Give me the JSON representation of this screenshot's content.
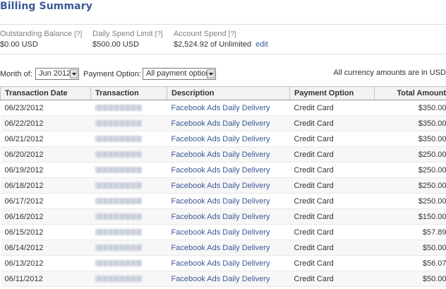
{
  "page": {
    "title": "Billing Summary"
  },
  "stats": {
    "outstanding": {
      "label": "Outstanding Balance",
      "help": "[?]",
      "value": "$0.00 USD"
    },
    "daily_limit": {
      "label": "Daily Spend Limit",
      "help": "[?]",
      "value": "$500.00 USD"
    },
    "account_spend": {
      "label": "Account Spend",
      "help": "[?]",
      "value": "$2,524.92 of Unlimited",
      "edit_link": "edit"
    }
  },
  "filters": {
    "month_label": "Month of:",
    "month_value": "Jun 2012",
    "payment_label": "Payment Option:",
    "payment_value": "All payment options",
    "currency_note": "All currency amounts are in USD"
  },
  "table": {
    "columns": [
      "Transaction Date",
      "Transaction",
      "Description",
      "Payment Option",
      "Total Amount"
    ],
    "rows": [
      {
        "date": "06/23/2012",
        "description": "Facebook Ads Daily Delivery",
        "payment": "Credit Card",
        "amount": "$350.00"
      },
      {
        "date": "06/22/2012",
        "description": "Facebook Ads Daily Delivery",
        "payment": "Credit Card",
        "amount": "$350.00"
      },
      {
        "date": "06/21/2012",
        "description": "Facebook Ads Daily Delivery",
        "payment": "Credit Card",
        "amount": "$350.00"
      },
      {
        "date": "06/20/2012",
        "description": "Facebook Ads Daily Delivery",
        "payment": "Credit Card",
        "amount": "$250.00"
      },
      {
        "date": "06/19/2012",
        "description": "Facebook Ads Daily Delivery",
        "payment": "Credit Card",
        "amount": "$250.00"
      },
      {
        "date": "06/18/2012",
        "description": "Facebook Ads Daily Delivery",
        "payment": "Credit Card",
        "amount": "$250.00"
      },
      {
        "date": "06/17/2012",
        "description": "Facebook Ads Daily Delivery",
        "payment": "Credit Card",
        "amount": "$250.00"
      },
      {
        "date": "06/16/2012",
        "description": "Facebook Ads Daily Delivery",
        "payment": "Credit Card",
        "amount": "$150.00"
      },
      {
        "date": "06/15/2012",
        "description": "Facebook Ads Daily Delivery",
        "payment": "Credit Card",
        "amount": "$57.89"
      },
      {
        "date": "06/14/2012",
        "description": "Facebook Ads Daily Delivery",
        "payment": "Credit Card",
        "amount": "$50.00"
      },
      {
        "date": "06/13/2012",
        "description": "Facebook Ads Daily Delivery",
        "payment": "Credit Card",
        "amount": "$56.07"
      },
      {
        "date": "06/11/2012",
        "description": "Facebook Ads Daily Delivery",
        "payment": "Credit Card",
        "amount": "$50.00"
      }
    ]
  },
  "colors": {
    "accent": "#3b5998",
    "header_bg": "#f2f2f2",
    "alt_row_bg": "#f7f7f7"
  }
}
